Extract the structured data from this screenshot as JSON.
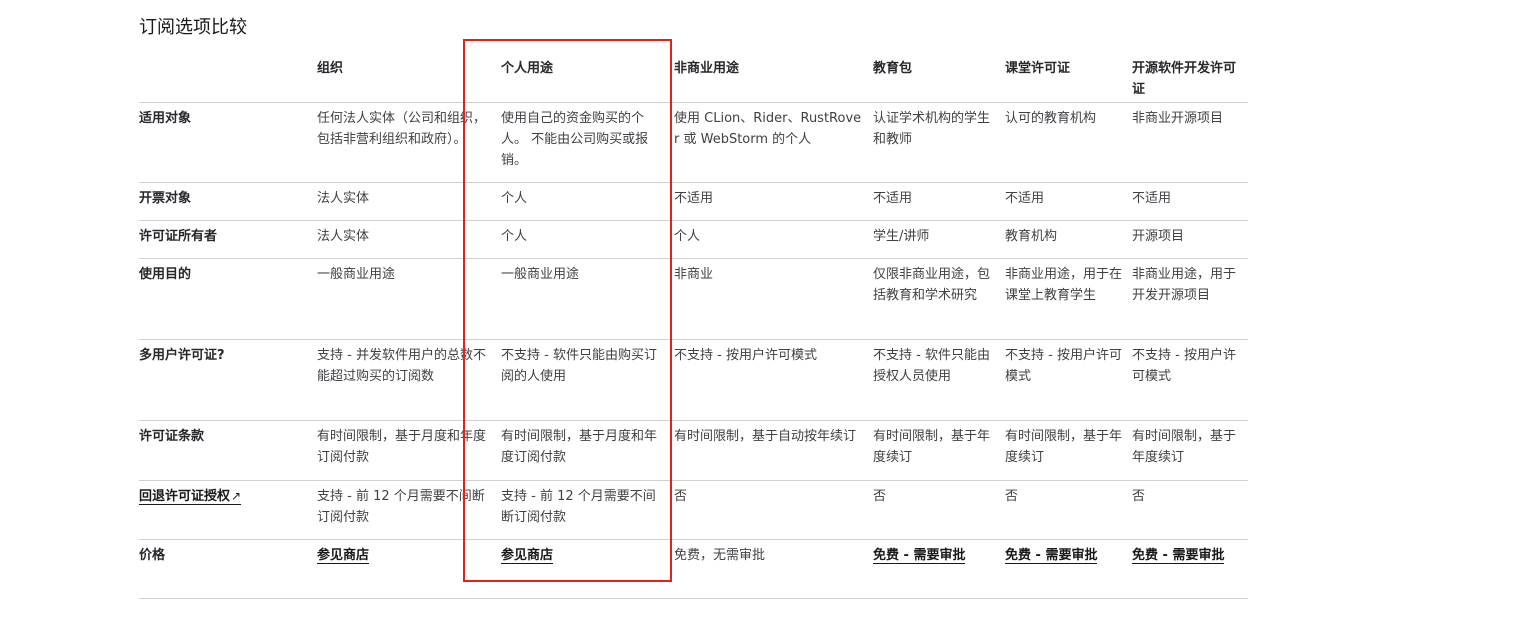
{
  "title": "订阅选项比较",
  "headers": [
    "",
    "组织",
    "个人用途",
    "非商业用途",
    "教育包",
    "课堂许可证",
    "开源软件开发许可证"
  ],
  "rows": [
    {
      "label": "适用对象",
      "cells": [
        "任何法人实体（公司和组织，包括非营利组织和政府）。",
        "使用自己的资金购买的个人。 不能由公司购买或报销。",
        "使用 CLion、Rider、RustRover 或 WebStorm 的个人",
        "认证学术机构的学生和教师",
        "认可的教育机构",
        "非商业开源项目"
      ]
    },
    {
      "label": "开票对象",
      "cells": [
        "法人实体",
        "个人",
        "不适用",
        "不适用",
        "不适用",
        "不适用"
      ]
    },
    {
      "label": "许可证所有者",
      "cells": [
        "法人实体",
        "个人",
        "个人",
        "学生/讲师",
        "教育机构",
        "开源项目"
      ]
    },
    {
      "label": "使用目的",
      "cells": [
        "一般商业用途",
        "一般商业用途",
        "非商业",
        "仅限非商业用途，包括教育和学术研究",
        "非商业用途，用于在课堂上教育学生",
        "非商业用途，用于开发开源项目"
      ]
    },
    {
      "label": "多用户许可证?",
      "cells": [
        "支持 - 并发软件用户的总数不能超过购买的订阅数",
        "不支持 - 软件只能由购买订阅的人使用",
        "不支持 - 按用户许可模式",
        "不支持 - 软件只能由授权人员使用",
        "不支持 - 按用户许可模式",
        "不支持 - 按用户许可模式"
      ]
    },
    {
      "label": "许可证条款",
      "cells": [
        "有时间限制，基于月度和年度订阅付款",
        "有时间限制，基于月度和年度订阅付款",
        "有时间限制，基于自动按年续订",
        "有时间限制，基于年度续订",
        "有时间限制，基于年度续订",
        "有时间限制，基于年度续订"
      ]
    },
    {
      "label": "回退许可证授权",
      "label_arrow": "↗",
      "cells": [
        "支持 - 前 12 个月需要不间断订阅付款",
        "支持 - 前 12 个月需要不间断订阅付款",
        "否",
        "否",
        "否",
        "否"
      ]
    },
    {
      "label": "价格",
      "cells": [
        "参见商店",
        "参见商店",
        "免费，无需审批",
        "免费 - 需要审批",
        "免费 - 需要审批",
        "免费 - 需要审批"
      ]
    }
  ],
  "highlight_color": "#e0241b"
}
